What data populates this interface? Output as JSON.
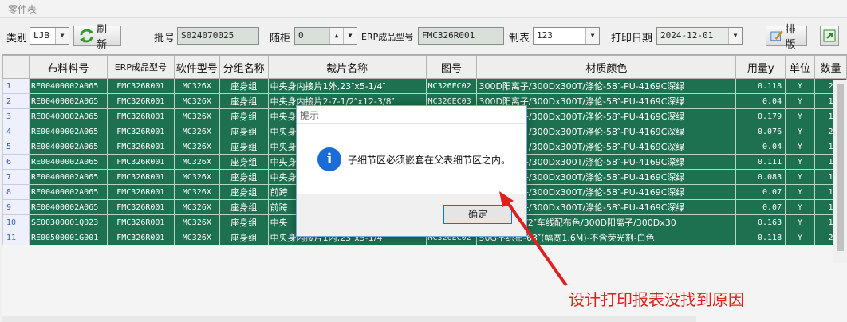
{
  "window": {
    "title": "零件表"
  },
  "toolbar": {
    "category_label": "类别",
    "category_value": "LJB",
    "refresh_label": "刷新",
    "batch_label": "批号",
    "batch_value": "S024070025",
    "cabinet_label": "随柜",
    "cabinet_value": "0",
    "erp_label": "ERP成品型号",
    "erp_value": "FMC326R001",
    "maker_label": "制表",
    "maker_value": "123",
    "print_date_label": "打印日期",
    "print_date_value": "2024-12-01",
    "layout_label": "排版"
  },
  "table": {
    "columns": [
      "布料料号",
      "ERP成品型号",
      "软件型号",
      "分组名称",
      "裁片名称",
      "图号",
      "材质颜色",
      "用量y",
      "单位",
      "数量"
    ],
    "rows": [
      {
        "n": "1",
        "cells": [
          "RE00400002A065",
          "FMC326R001",
          "MC326X",
          "座身组",
          "中央身内接片1外,23″x5-1/4″",
          "MC326EC02",
          "300D阳离子/300Dx300T/涤伦-58″-PU-4169C深绿",
          "0.118",
          "Y",
          "2"
        ]
      },
      {
        "n": "2",
        "cells": [
          "RE00400002A065",
          "FMC326R001",
          "MC326X",
          "座身组",
          "中央身内接片2-7-1/2″x12-3/8″",
          "MC326EC03",
          "300D阳离子/300Dx300T/涤伦-58″-PU-4169C深绿",
          "0.04",
          "Y",
          "1"
        ]
      },
      {
        "n": "3",
        "cells": [
          "RE00400002A065",
          "FMC326R001",
          "MC326X",
          "座身组",
          "中央身",
          "",
          "300D阳离子/300Dx300T/涤伦-58″-PU-4169C深绿",
          "0.179",
          "Y",
          "1"
        ]
      },
      {
        "n": "4",
        "cells": [
          "RE00400002A065",
          "FMC326R001",
          "MC326X",
          "座身组",
          "中央身",
          "",
          "300D阳离子/300Dx300T/涤伦-58″-PU-4169C深绿",
          "0.076",
          "Y",
          "2"
        ]
      },
      {
        "n": "5",
        "cells": [
          "RE00400002A065",
          "FMC326R001",
          "MC326X",
          "座身组",
          "中央身",
          "",
          "300D阳离子/300Dx300T/涤伦-58″-PU-4169C深绿",
          "0.04",
          "Y",
          "1"
        ]
      },
      {
        "n": "6",
        "cells": [
          "RE00400002A065",
          "FMC326R001",
          "MC326X",
          "座身组",
          "中央身",
          "",
          "300D阳离子/300Dx300T/涤伦-58″-PU-4169C深绿",
          "0.111",
          "Y",
          "1"
        ]
      },
      {
        "n": "7",
        "cells": [
          "RE00400002A065",
          "FMC326R001",
          "MC326X",
          "座身组",
          "中央身",
          "",
          "300D阳离子/300Dx300T/涤伦-58″-PU-4169C深绿",
          "0.083",
          "Y",
          "1"
        ]
      },
      {
        "n": "8",
        "cells": [
          "RE00400002A065",
          "FMC326R001",
          "MC326X",
          "座身组",
          "前跨",
          "",
          "300D阳离子/300Dx300T/涤伦-58″-PU-4169C深绿",
          "0.07",
          "Y",
          "1"
        ]
      },
      {
        "n": "9",
        "cells": [
          "RE00400002A065",
          "FMC326R001",
          "MC326X",
          "座身组",
          "前跨",
          "",
          "300D阳离子/300Dx300T/涤伦-58″-PU-4169C深绿",
          "0.07",
          "Y",
          "1"
        ]
      },
      {
        "n": "10",
        "cells": [
          "SE00300001Q023",
          "FMC326R001",
          "MC326X",
          "座身组",
          "中央",
          "",
          "角线1″x1-1/2″车线配布色/300D阳离子/300Dx30",
          "0.163",
          "Y",
          "1"
        ]
      },
      {
        "n": "11",
        "cells": [
          "RE00500001G001",
          "FMC326R001",
          "MC326X",
          "座身组",
          "中央身内接片1内,23″x5-1/4″",
          "MC326EC02",
          "50G不织布-63″(幅宽1.6M)-不含荧光剂-白色",
          "0.118",
          "Y",
          "2"
        ]
      }
    ]
  },
  "dialog": {
    "title": "提示",
    "message": "子细节区必须嵌套在父表细节区之内。",
    "ok_label": "确定"
  },
  "annotation": {
    "text": "设计打印报表没找到原因",
    "color": "#e02020"
  },
  "colors": {
    "row_bg": "#1d7050",
    "accent": "#1a6dd6"
  },
  "icons": {
    "refresh": "refresh-arrows-icon",
    "layout": "layout-pencil-icon",
    "export": "export-icon",
    "info": "info-icon",
    "close": "close-icon"
  }
}
